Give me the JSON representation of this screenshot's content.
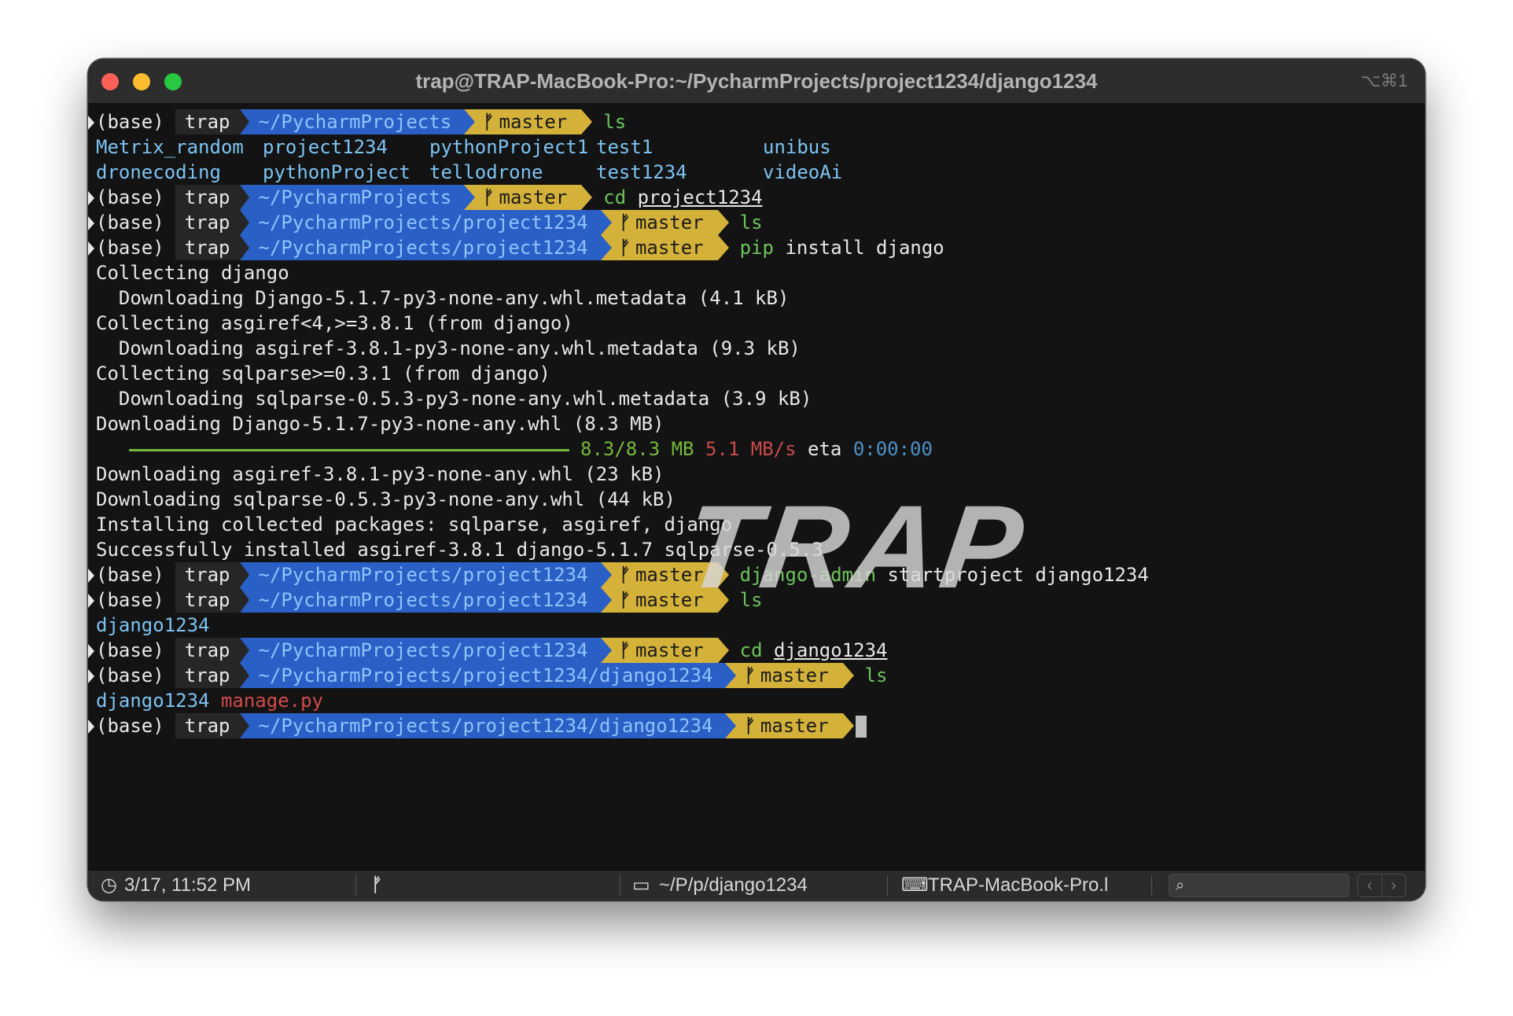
{
  "window": {
    "title": "trap@TRAP-MacBook-Pro:~/PycharmProjects/project1234/django1234",
    "shortcut": "⌥⌘1"
  },
  "prompt": {
    "env": "(base)",
    "user": "trap",
    "branch": "master",
    "branch_icon": "",
    "dir_root": "~/PycharmProjects",
    "dir_project": "~/PycharmProjects/project1234",
    "dir_django": "~/PycharmProjects/project1234/django1234"
  },
  "commands": {
    "ls": "ls",
    "cd": "cd",
    "cd_project_arg": "project1234",
    "pip": "pip",
    "pip_args": " install django",
    "django_admin": "django-admin",
    "django_admin_args": " startproject django1234",
    "cd_django_arg": "django1234"
  },
  "ls_output": {
    "row1": [
      "Metrix_random",
      "project1234",
      "pythonProject1",
      "test1",
      "unibus"
    ],
    "row2": [
      "dronecoding",
      "pythonProject",
      "tellodrone",
      "test1234",
      "videoAi"
    ]
  },
  "pip_output": {
    "l1": "Collecting django",
    "l2": "  Downloading Django-5.1.7-py3-none-any.whl.metadata (4.1 kB)",
    "l3": "Collecting asgiref<4,>=3.8.1 (from django)",
    "l4": "  Downloading asgiref-3.8.1-py3-none-any.whl.metadata (9.3 kB)",
    "l5": "Collecting sqlparse>=0.3.1 (from django)",
    "l6": "  Downloading sqlparse-0.5.3-py3-none-any.whl.metadata (3.9 kB)",
    "l7": "Downloading Django-5.1.7-py3-none-any.whl (8.3 MB)",
    "progress_size": "8.3/8.3 MB",
    "progress_speed": "5.1 MB/s",
    "progress_eta_label": "eta",
    "progress_eta": "0:00:00",
    "l8": "Downloading asgiref-3.8.1-py3-none-any.whl (23 kB)",
    "l9": "Downloading sqlparse-0.5.3-py3-none-any.whl (44 kB)",
    "l10": "Installing collected packages: sqlparse, asgiref, django",
    "l11": "Successfully installed asgiref-3.8.1 django-5.1.7 sqlparse-0.5.3"
  },
  "ls_project_output": "django1234",
  "ls_django_output": {
    "dir": "django1234",
    "file": "manage.py"
  },
  "watermark": "TRAP",
  "statusbar": {
    "clock": "3/17, 11:52 PM",
    "path": "~/P/p/django1234",
    "host": "TRAP-MacBook-Pro.l",
    "nav_prev": "‹",
    "nav_next": "›"
  },
  "colors": {
    "dir_segment": "#2a5fc6",
    "git_segment": "#d4b23a",
    "command": "#6cc35b",
    "directory_listing": "#7cc3f2"
  }
}
